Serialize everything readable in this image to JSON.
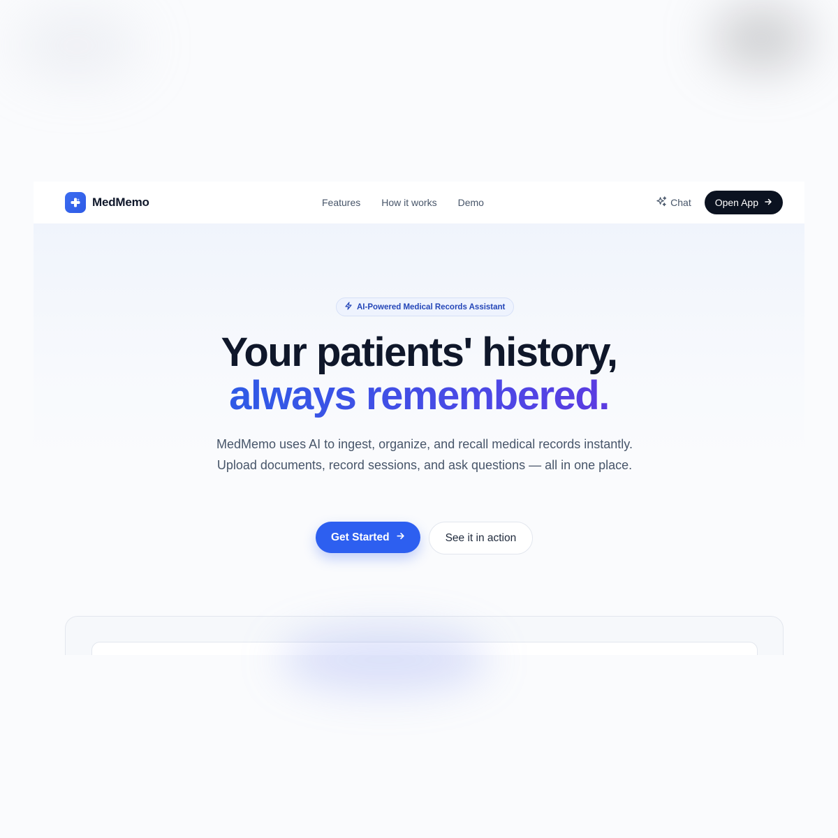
{
  "brand": {
    "name": "MedMemo",
    "accent": "#2d5ff0",
    "dark": "#0b1220"
  },
  "nav": {
    "links": [
      {
        "label": "Features"
      },
      {
        "label": "How it works"
      },
      {
        "label": "Demo"
      }
    ],
    "chat_label": "Chat",
    "chat_icon": "sparkles-icon",
    "open_app_label": "Open App",
    "open_app_icon": "arrow-right-icon"
  },
  "hero": {
    "badge": {
      "icon": "zap-icon",
      "label": "AI-Powered Medical Records Assistant"
    },
    "title_line1": "Your patients' history,",
    "title_line2": "always remembered.",
    "subtitle": "MedMemo uses AI to ingest, organize, and recall medical records instantly. Upload documents, record sessions, and ask questions — all in one place.",
    "primary_cta": "Get Started",
    "secondary_cta": "See it in action"
  }
}
